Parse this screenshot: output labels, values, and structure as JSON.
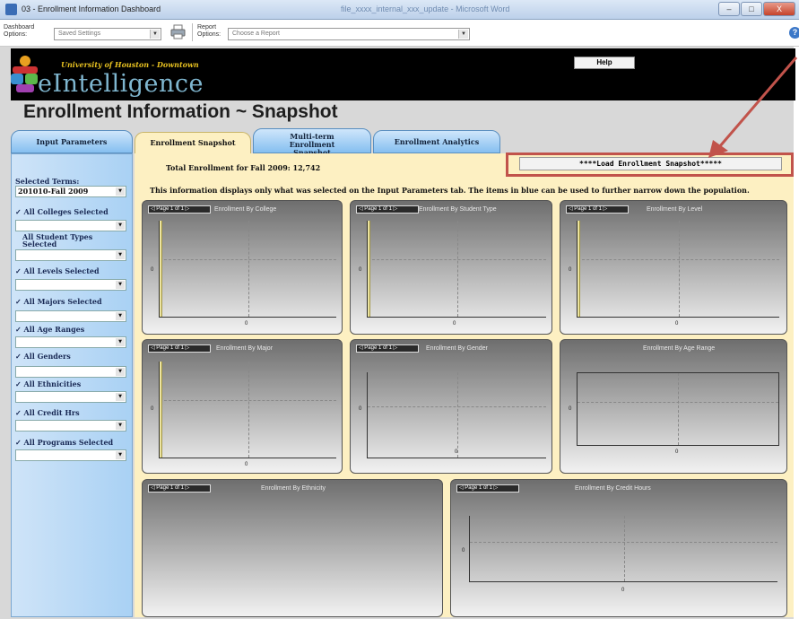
{
  "window": {
    "title": "03 - Enrollment Information Dashboard",
    "title_faded": "file_xxxx_internal_xxx_update - Microsoft Word",
    "btn_min": "–",
    "btn_max": "□",
    "btn_close": "X"
  },
  "toolbar": {
    "dashboard_label": "Dashboard Options:",
    "saved_settings": "Saved Settings",
    "report_label": "Report Options:",
    "report_placeholder": "Choose a Report",
    "help_q": "?"
  },
  "banner": {
    "university": "University of Houston - Downtown",
    "brand": "eIntelligence",
    "help": "Help"
  },
  "page": {
    "title": "Enrollment Information ~ Snapshot"
  },
  "tabs": [
    "Input Parameters",
    "Enrollment Snapshot",
    "Multi-term Enrollment Snapshot",
    "Enrollment Analytics"
  ],
  "sidebar": {
    "terms_label": "Selected Terms:",
    "terms_value": "201010-Fall 2009",
    "filters": [
      "All Colleges Selected",
      "All Student Types Selected",
      "All Levels Selected",
      "All Majors Selected",
      "All Age Ranges",
      "All Genders",
      "All Ethnicities",
      "All Credit Hrs",
      "All Programs Selected"
    ]
  },
  "main": {
    "total": "Total Enrollment for Fall 2009:  12,742",
    "load_button": "****Load Enrollment Snapshot*****",
    "info": "This information displays only what was selected on the Input Parameters tab.  The items in blue can be used to further narrow down the population.",
    "page_label": "Page 1 of 1",
    "zero": "0",
    "charts": [
      "Enrollment By College",
      "Enrollment By Student Type",
      "Enrollment By Level",
      "Enrollment By Major",
      "Enrollment By Gender",
      "Enrollment By Age Range",
      "Enrollment By Ethnicity",
      "Enrollment By Credit Hours"
    ]
  },
  "colors": {
    "banner": "#000000",
    "sidebar": "#a9d1f4",
    "main": "#fdf0c2",
    "highlight": "#c1534b"
  }
}
